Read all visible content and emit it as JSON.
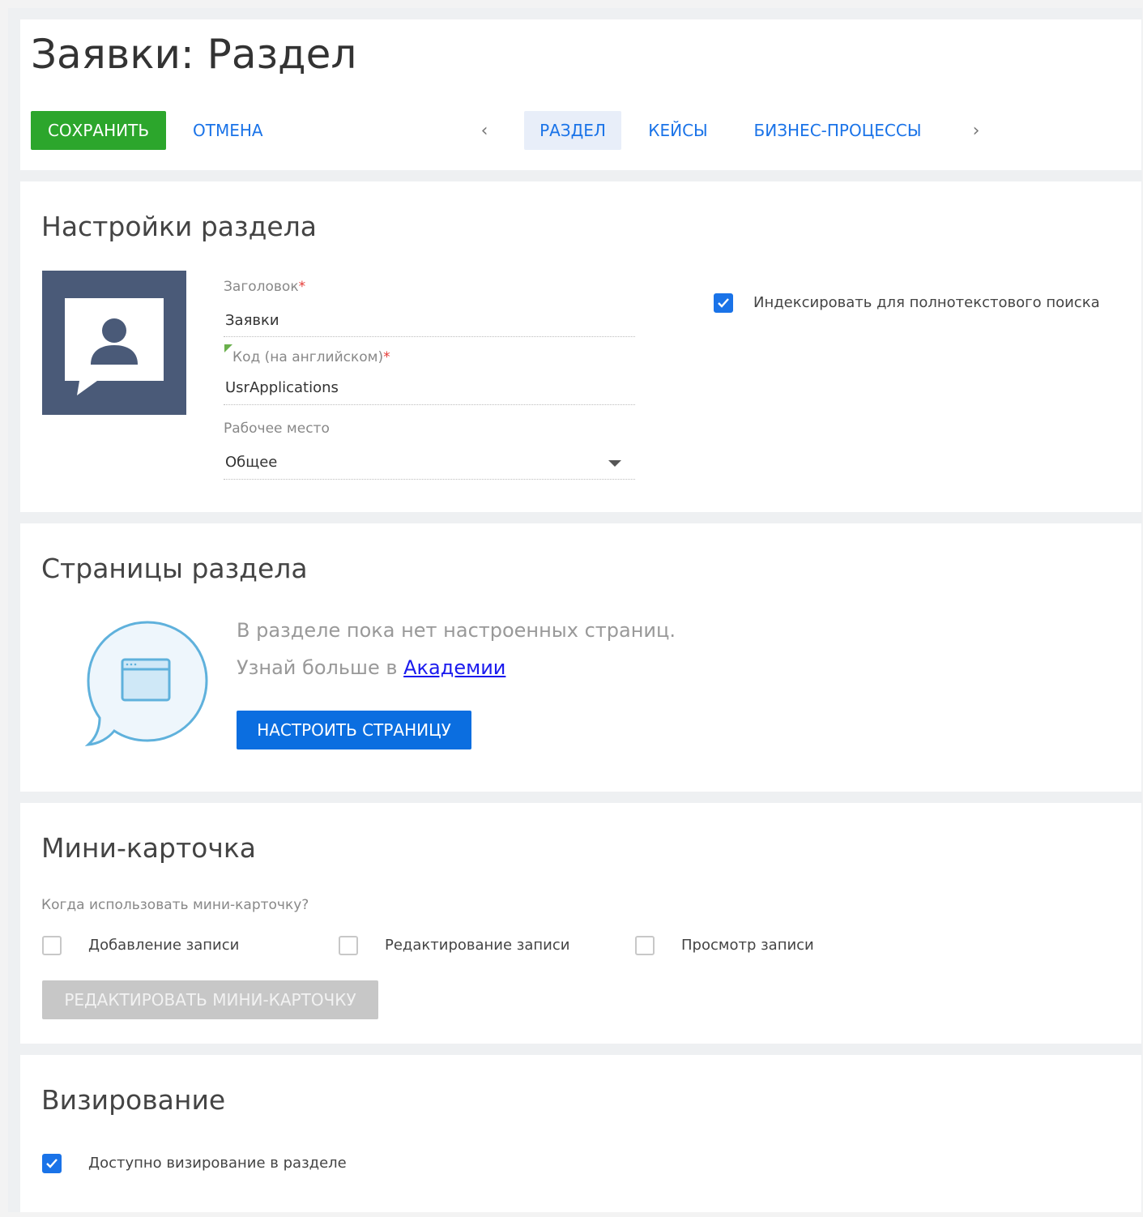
{
  "header": {
    "title": "Заявки: Раздел",
    "save_label": "СОХРАНИТЬ",
    "cancel_label": "ОТМЕНА",
    "prev_arrow": "‹",
    "next_arrow": "›",
    "tabs": [
      {
        "label": "РАЗДЕЛ",
        "active": true
      },
      {
        "label": "КЕЙСЫ",
        "active": false
      },
      {
        "label": "БИЗНЕС-ПРОЦЕССЫ",
        "active": false
      }
    ]
  },
  "settings": {
    "title": "Настройки раздела",
    "avatar_icon": "user-card-icon",
    "title_field": {
      "label": "Заголовок",
      "required": "*",
      "value": "Заявки"
    },
    "code_field": {
      "label": "Код (на английском)",
      "required": "*",
      "value": "UsrApplications"
    },
    "workplace_field": {
      "label": "Рабочее место",
      "value": "Общее"
    },
    "fulltext_index": {
      "label": "Индексировать для полнотекстового поиска",
      "checked": true
    }
  },
  "pages": {
    "title": "Страницы раздела",
    "empty_text": "В разделе пока нет настроенных страниц.",
    "learn_more_prefix": "Узнай больше в ",
    "learn_more_link": "Академии",
    "configure_label": "НАСТРОИТЬ СТРАНИЦУ",
    "illustration_icon": "page-bubble-icon"
  },
  "minicard": {
    "title": "Мини-карточка",
    "question": "Когда использовать мини-карточку?",
    "options": [
      {
        "label": "Добавление записи",
        "checked": false
      },
      {
        "label": "Редактирование записи",
        "checked": false
      },
      {
        "label": "Просмотр записи",
        "checked": false
      }
    ],
    "edit_label": "РЕДАКТИРОВАТЬ МИНИ-КАРТОЧКУ"
  },
  "visa": {
    "title": "Визирование",
    "option": {
      "label": "Доступно визирование в разделе",
      "checked": true
    }
  },
  "colors": {
    "save": "#2ca62c",
    "primary": "#0b6ee0",
    "link": "#1a73e8",
    "avatar_bg": "#4a5a78",
    "disabled": "#c7c7c7"
  }
}
